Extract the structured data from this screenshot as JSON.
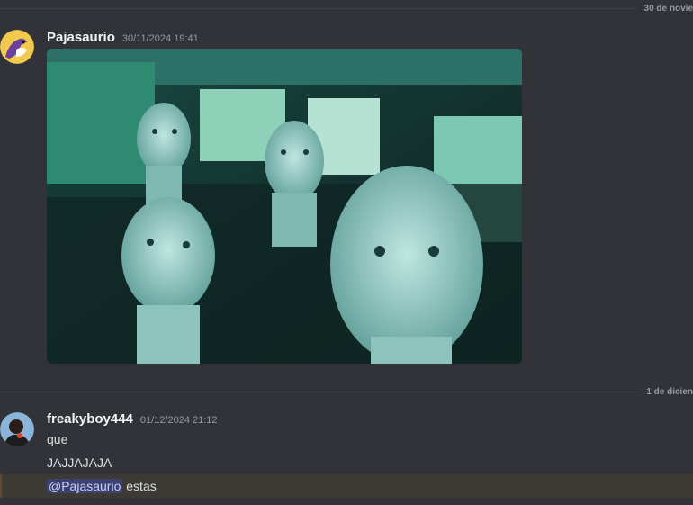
{
  "dividers": [
    {
      "date": "30 de novie"
    },
    {
      "date": "1 de dicien"
    }
  ],
  "messages": [
    {
      "username": "Pajasaurio",
      "timestamp": "30/11/2024 19:41",
      "avatar_icon": "bird-avatar-icon"
    },
    {
      "username": "freakyboy444",
      "timestamp": "01/12/2024 21:12",
      "avatar_icon": "person-avatar-icon",
      "lines": [
        "que",
        "JAJJAJAJA"
      ],
      "mention": "@Pajasaurio",
      "mention_suffix": " estas"
    }
  ],
  "colors": {
    "background": "#313338",
    "mention_bg": "#3c4270",
    "highlight_bg": "#3d3a35"
  }
}
